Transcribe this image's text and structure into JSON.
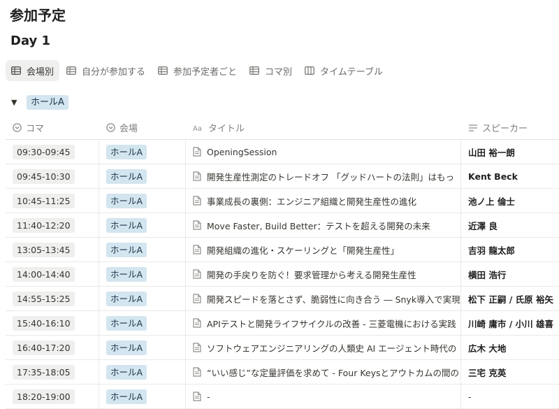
{
  "page": {
    "title": "参加予定",
    "subtitle": "Day 1"
  },
  "tabs": [
    {
      "label": "会場別",
      "icon": "table-icon",
      "active": true
    },
    {
      "label": "自分が参加する",
      "icon": "table-icon"
    },
    {
      "label": "参加予定者ごと",
      "icon": "table-icon"
    },
    {
      "label": "コマ別",
      "icon": "table-icon"
    },
    {
      "label": "タイムテーブル",
      "icon": "timeline-icon"
    }
  ],
  "group": {
    "label": "ホールA"
  },
  "columns": {
    "time": "コマ",
    "hall": "会場",
    "title": "タイトル",
    "speaker": "スピーカー"
  },
  "rows": [
    {
      "time": "09:30-09:45",
      "hall": "ホールA",
      "title": "OpeningSession",
      "speaker": "山田 裕一朗"
    },
    {
      "time": "09:45-10:30",
      "hall": "ホールA",
      "title": "開発生産性測定のトレードオフ 「グッドハートの法則」はもっ",
      "speaker": "Kent Beck"
    },
    {
      "time": "10:45-11:25",
      "hall": "ホールA",
      "title": "事業成長の裏側：エンジニア組織と開発生産性の進化",
      "speaker": "池ノ上 倫士"
    },
    {
      "time": "11:40-12:20",
      "hall": "ホールA",
      "title": "Move Faster, Build Better：テストを超える開発の未来",
      "speaker": "近澤 良"
    },
    {
      "time": "13:05-13:45",
      "hall": "ホールA",
      "title": "開発組織の進化・スケーリングと「開発生産性」",
      "speaker": "吉羽 龍太郎"
    },
    {
      "time": "14:00-14:40",
      "hall": "ホールA",
      "title": "開発の手戻りを防ぐ！要求管理から考える開発生産性",
      "speaker": "横田 浩行"
    },
    {
      "time": "14:55-15:25",
      "hall": "ホールA",
      "title": "開発スピードを落とさず、脆弱性に向き合う ― Snyk導入で実現",
      "speaker": "松下 正嗣 / 氏原 裕矢"
    },
    {
      "time": "15:40-16:10",
      "hall": "ホールA",
      "title": "APIテストと開発ライフサイクルの改善 - 三菱電機における実践",
      "speaker": "川崎 庸市 / 小川 雄喜"
    },
    {
      "time": "16:40-17:20",
      "hall": "ホールA",
      "title": "ソフトウェアエンジニアリングの人類史 AI エージェント時代の",
      "speaker": "広木 大地"
    },
    {
      "time": "17:35-18:05",
      "hall": "ホールA",
      "title": "“いい感じ”な定量評価を求めて - Four Keysとアウトカムの間の",
      "speaker": "三宅 克英"
    },
    {
      "time": "18:20-19:00",
      "hall": "ホールA",
      "title": "-",
      "speaker": "-"
    }
  ]
}
